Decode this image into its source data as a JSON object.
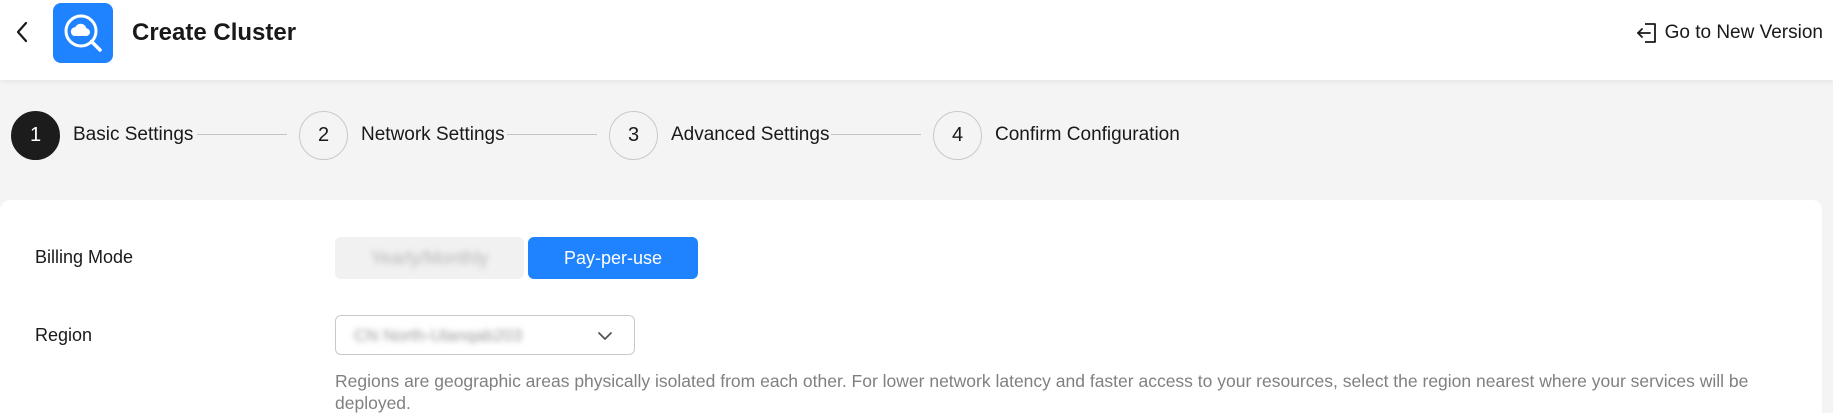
{
  "header": {
    "back_icon": "chevron-left-icon",
    "logo_icon": "cloud-search-icon",
    "title": "Create Cluster",
    "new_version_label": "Go to New Version",
    "new_version_icon": "exit-icon"
  },
  "steps": [
    {
      "number": "1",
      "label": "Basic Settings",
      "active": true
    },
    {
      "number": "2",
      "label": "Network Settings",
      "active": false
    },
    {
      "number": "3",
      "label": "Advanced Settings",
      "active": false
    },
    {
      "number": "4",
      "label": "Confirm Configuration",
      "active": false
    }
  ],
  "form": {
    "billing": {
      "label": "Billing Mode",
      "options": [
        "Yearly/Monthly",
        "Pay-per-use"
      ],
      "selected": "Pay-per-use"
    },
    "region": {
      "label": "Region",
      "value": "CN North-Ulanqab203",
      "help": "Regions are geographic areas physically isolated from each other. For lower network latency and faster access to your resources, select the region nearest where your services will be deployed."
    }
  },
  "colors": {
    "primary": "#1f83ff",
    "active_step": "#1c1c1c",
    "page_bg": "#f4f4f4",
    "help_text": "#808080"
  }
}
